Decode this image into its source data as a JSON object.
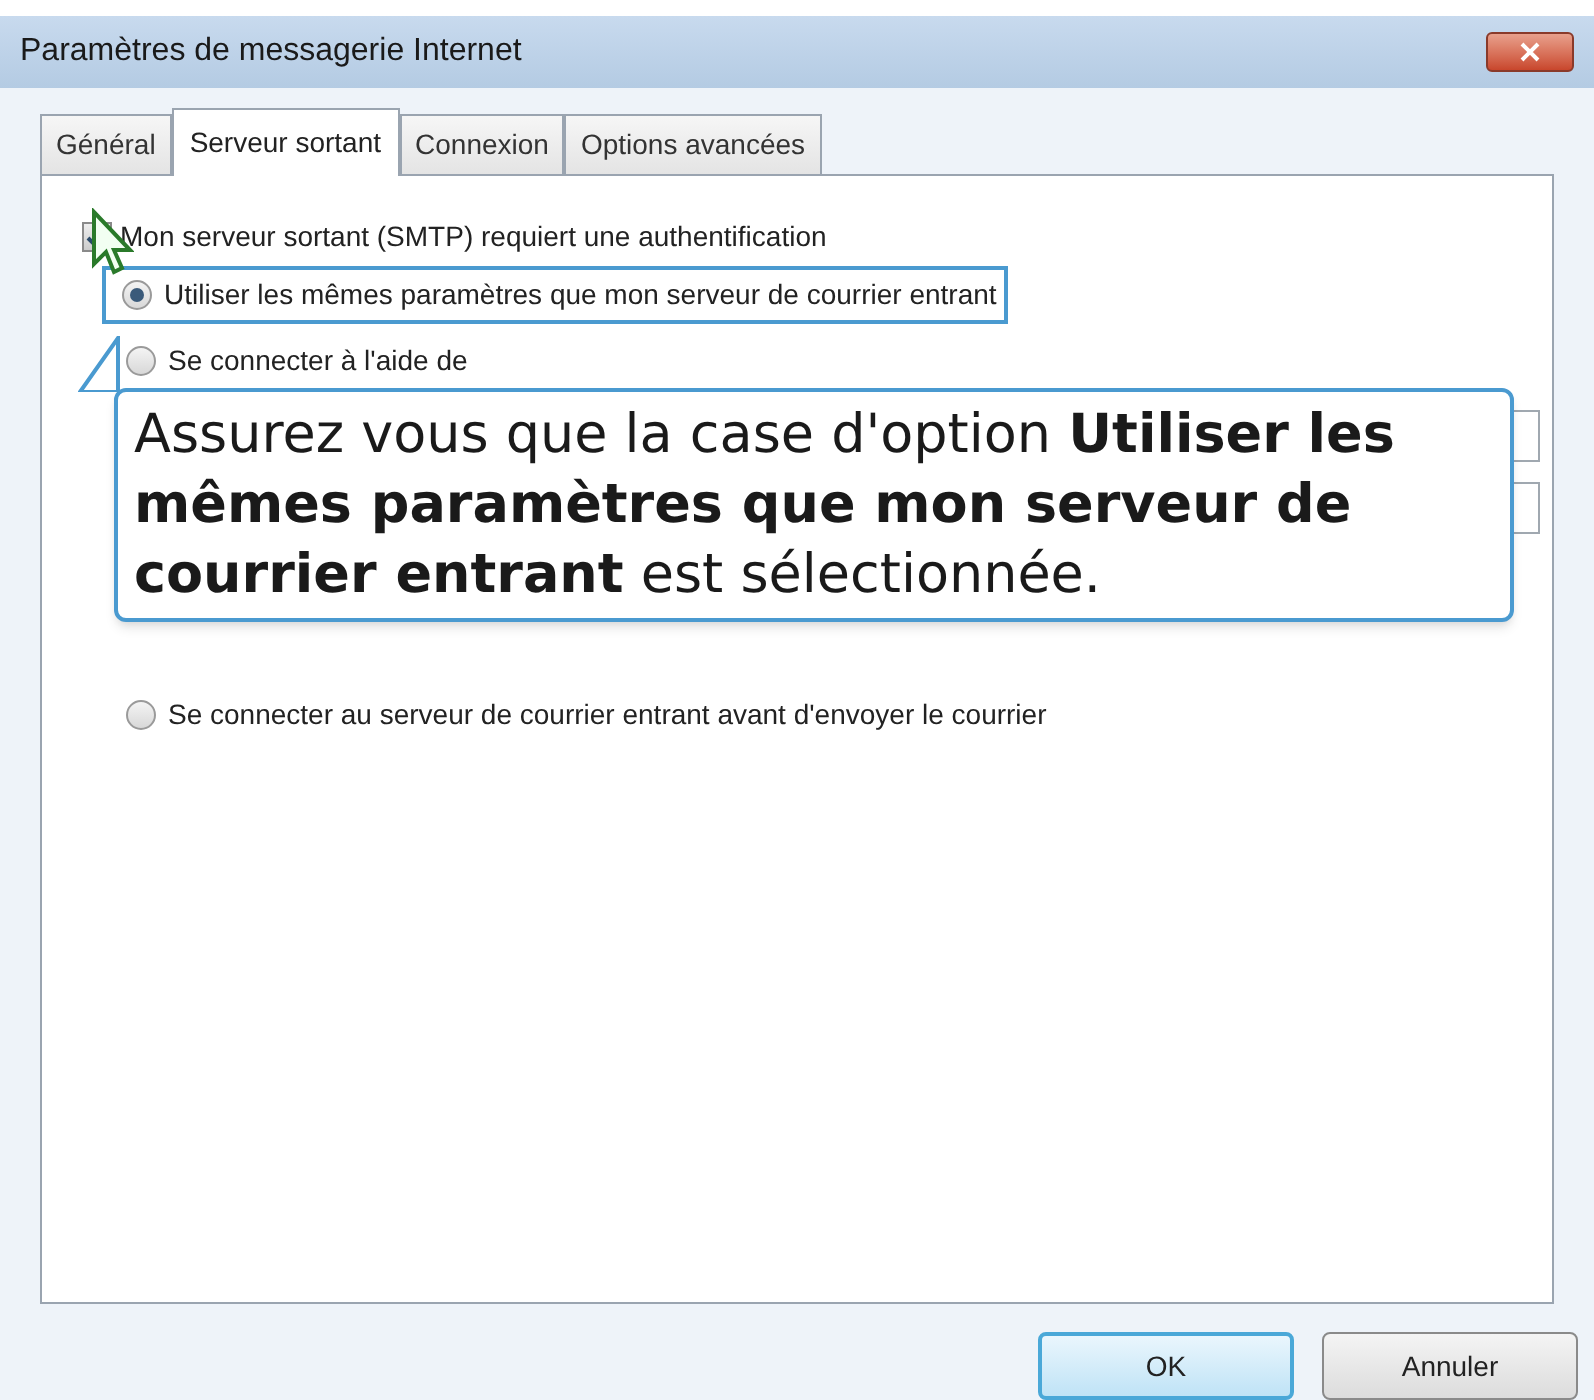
{
  "window": {
    "title": "Paramètres de messagerie Internet"
  },
  "tabs": [
    {
      "label": "Général",
      "selected": false
    },
    {
      "label": "Serveur sortant",
      "selected": true
    },
    {
      "label": "Connexion",
      "selected": false
    },
    {
      "label": "Options avancées",
      "selected": false
    }
  ],
  "auth_checkbox": {
    "label": "Mon serveur sortant (SMTP) requiert une authentification",
    "checked": true
  },
  "auth_options": [
    {
      "label": "Utiliser les mêmes paramètres que mon serveur de courrier entrant",
      "selected": true,
      "highlighted": true
    },
    {
      "label": "Se connecter à l'aide de",
      "selected": false,
      "highlighted": false
    }
  ],
  "callout": {
    "text": "Assurez vous que la case d'option **Utiliser les mêmes paramètres que mon serveur de courrier entrant** est sélectionnée."
  },
  "other_option": {
    "label": "Se connecter au serveur de courrier entrant avant d'envoyer le courrier",
    "selected": false
  },
  "buttons": [
    {
      "label": "OK",
      "kind": "default"
    },
    {
      "label": "Annuler",
      "kind": "normal"
    }
  ]
}
